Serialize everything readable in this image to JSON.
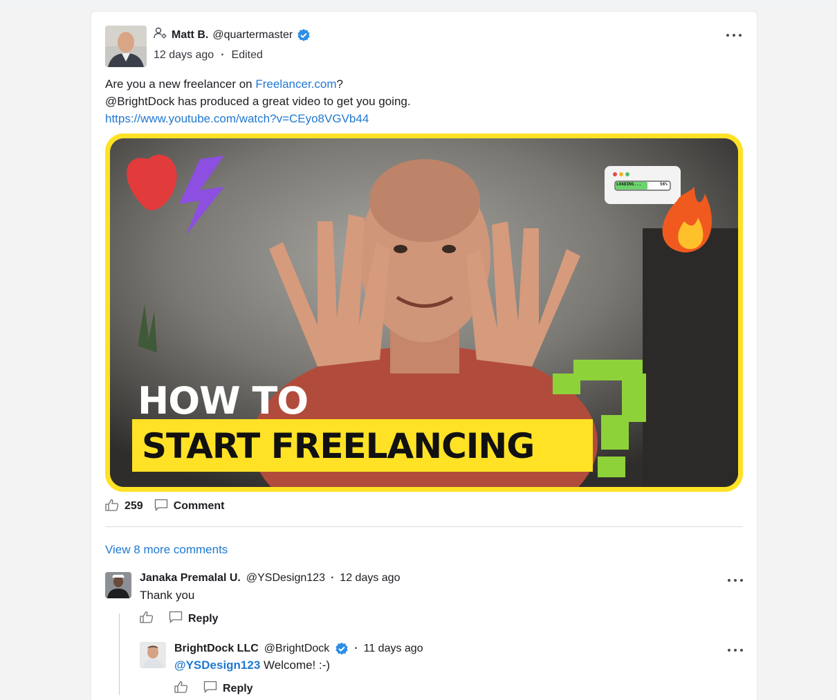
{
  "post": {
    "author": {
      "name": "Matt B.",
      "handle": "@quartermaster",
      "verified": true
    },
    "timestamp": "12 days ago",
    "edited_label": "Edited",
    "body": {
      "line1_prefix": "Are you a new freelancer on ",
      "line1_link": "Freelancer.com",
      "line1_suffix": "?",
      "line2": "@BrightDock has produced a great video to get you going.",
      "url": "https://www.youtube.com/watch?v=CEyo8VGVb44"
    },
    "thumbnail": {
      "line1": "HOW TO",
      "line2": "START FREELANCING",
      "loading_badge": "LOADING...",
      "loading_pct": "56%"
    },
    "likes": "259",
    "comment_label": "Comment"
  },
  "comments": {
    "view_more": "View 8 more comments",
    "items": [
      {
        "name": "Janaka Premalal U.",
        "handle": "@YSDesign123",
        "time": "12 days ago",
        "text": "Thank you",
        "reply_label": "Reply"
      },
      {
        "name": "BrightDock LLC",
        "handle": "@BrightDock",
        "verified": true,
        "time": "11 days ago",
        "mention": "@YSDesign123",
        "text": " Welcome! :-)",
        "reply_label": "Reply"
      }
    ]
  },
  "separator": "·",
  "colors": {
    "link": "#1f78d1",
    "verified": "#2f8de4",
    "thumb_border": "#ffe226"
  }
}
